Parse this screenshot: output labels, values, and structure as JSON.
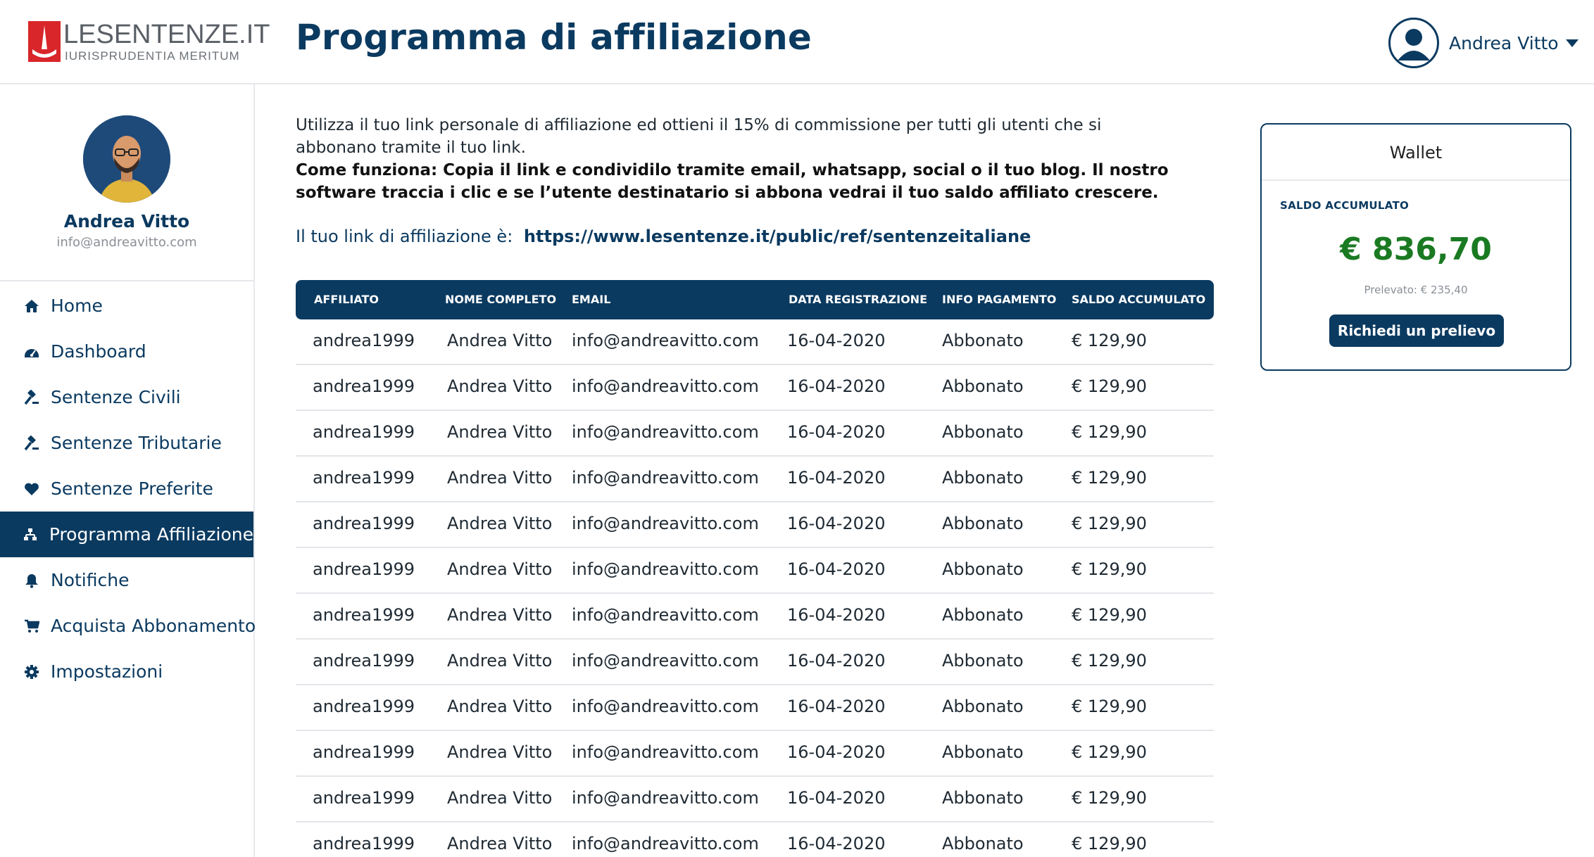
{
  "brand": {
    "name": "LESENTENZE.IT",
    "tagline": "IURISPRUDENTIA MERITUM",
    "color": "#0b3a60",
    "logo_color": "#d8262a"
  },
  "header": {
    "title": "Programma di affiliazione",
    "user_name": "Andrea Vitto",
    "user_icon": "user-circle-icon",
    "menu_icon": "caret-down-icon"
  },
  "profile": {
    "name": "Andrea Vitto",
    "email": "info@andreavitto.com"
  },
  "sidebar": {
    "items": [
      {
        "label": "Home",
        "icon": "home-icon",
        "active": false
      },
      {
        "label": "Dashboard",
        "icon": "dashboard-icon",
        "active": false
      },
      {
        "label": "Sentenze Civili",
        "icon": "gavel-icon",
        "active": false
      },
      {
        "label": "Sentenze Tributarie",
        "icon": "gavel-icon",
        "active": false
      },
      {
        "label": "Sentenze Preferite",
        "icon": "heart-icon",
        "active": false
      },
      {
        "label": "Programma Affiliazione",
        "icon": "sitemap-icon",
        "active": true
      },
      {
        "label": "Notifiche",
        "icon": "bell-icon",
        "active": false
      },
      {
        "label": "Acquista Abbonamento",
        "icon": "cart-icon",
        "active": false
      },
      {
        "label": "Impostazioni",
        "icon": "gear-icon",
        "active": false
      }
    ]
  },
  "intro": {
    "text": "Utilizza il tuo link personale di affiliazione ed ottieni il 15% di commissione per tutti gli utenti che si abbonano tramite il tuo link.",
    "how_it_works": "Come funziona: Copia il link e condividilo tramite email, whatsapp, social o il tuo blog. Il nostro software traccia i clic e se l’utente destinatario si abbona vedrai il tuo saldo affiliato crescere."
  },
  "referral": {
    "label": "Il tuo link di affiliazione è:",
    "link": "https://www.lesentenze.it/public/ref/sentenzeitaliane"
  },
  "table": {
    "columns": [
      "AFFILIATO",
      "NOME COMPLETO",
      "EMAIL",
      "DATA REGISTRAZIONE",
      "INFO PAGAMENTO",
      "SALDO ACCUMULATO"
    ],
    "rows": [
      [
        "andrea1999",
        "Andrea Vitto",
        "info@andreavitto.com",
        "16-04-2020",
        "Abbonato",
        "€ 129,90"
      ],
      [
        "andrea1999",
        "Andrea Vitto",
        "info@andreavitto.com",
        "16-04-2020",
        "Abbonato",
        "€ 129,90"
      ],
      [
        "andrea1999",
        "Andrea Vitto",
        "info@andreavitto.com",
        "16-04-2020",
        "Abbonato",
        "€ 129,90"
      ],
      [
        "andrea1999",
        "Andrea Vitto",
        "info@andreavitto.com",
        "16-04-2020",
        "Abbonato",
        "€ 129,90"
      ],
      [
        "andrea1999",
        "Andrea Vitto",
        "info@andreavitto.com",
        "16-04-2020",
        "Abbonato",
        "€ 129,90"
      ],
      [
        "andrea1999",
        "Andrea Vitto",
        "info@andreavitto.com",
        "16-04-2020",
        "Abbonato",
        "€ 129,90"
      ],
      [
        "andrea1999",
        "Andrea Vitto",
        "info@andreavitto.com",
        "16-04-2020",
        "Abbonato",
        "€ 129,90"
      ],
      [
        "andrea1999",
        "Andrea Vitto",
        "info@andreavitto.com",
        "16-04-2020",
        "Abbonato",
        "€ 129,90"
      ],
      [
        "andrea1999",
        "Andrea Vitto",
        "info@andreavitto.com",
        "16-04-2020",
        "Abbonato",
        "€ 129,90"
      ],
      [
        "andrea1999",
        "Andrea Vitto",
        "info@andreavitto.com",
        "16-04-2020",
        "Abbonato",
        "€ 129,90"
      ],
      [
        "andrea1999",
        "Andrea Vitto",
        "info@andreavitto.com",
        "16-04-2020",
        "Abbonato",
        "€ 129,90"
      ],
      [
        "andrea1999",
        "Andrea Vitto",
        "info@andreavitto.com",
        "16-04-2020",
        "Abbonato",
        "€ 129,90"
      ]
    ]
  },
  "wallet": {
    "title": "Wallet",
    "balance_label": "SALDO ACCUMULATO",
    "balance": "€ 836,70",
    "withdrawn": "Prelevato:  € 235,40",
    "withdraw_button": "Richiedi un prelievo",
    "balance_color": "#1a7a22"
  }
}
